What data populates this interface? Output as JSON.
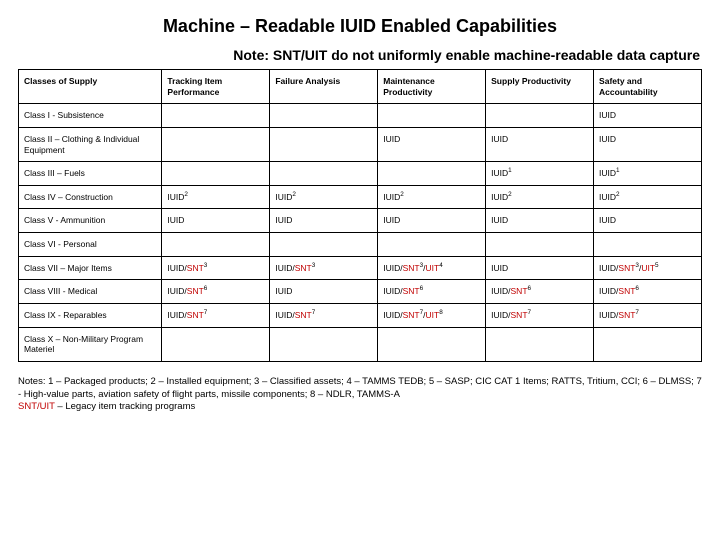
{
  "title": "Machine – Readable IUID Enabled Capabilities",
  "note_prefix": "Note: ",
  "note_body": "SNT/UIT do not uniformly enable machine-readable data capture",
  "headers": {
    "c0": "Classes of Supply",
    "c1": "Tracking Item Performance",
    "c2": "Failure Analysis",
    "c3": "Maintenance Productivity",
    "c4": "Supply Productivity",
    "c5": "Safety and Accountability"
  },
  "rows": [
    {
      "label": "Class I - Subsistence",
      "cells": [
        {
          "t": ""
        },
        {
          "t": ""
        },
        {
          "t": ""
        },
        {
          "t": ""
        },
        {
          "t": "IUID"
        }
      ]
    },
    {
      "label": "Class II – Clothing & Individual Equipment",
      "cells": [
        {
          "t": ""
        },
        {
          "t": ""
        },
        {
          "t": "IUID"
        },
        {
          "t": "IUID"
        },
        {
          "t": "IUID"
        }
      ]
    },
    {
      "label": "Class III – Fuels",
      "cells": [
        {
          "t": ""
        },
        {
          "t": ""
        },
        {
          "t": ""
        },
        {
          "t": "IUID",
          "sup": "1"
        },
        {
          "t": "IUID",
          "sup": "1"
        }
      ]
    },
    {
      "label": "Class IV – Construction",
      "cells": [
        {
          "t": "IUID",
          "sup": "2"
        },
        {
          "t": "IUID",
          "sup": "2"
        },
        {
          "t": "IUID",
          "sup": "2"
        },
        {
          "t": "IUID",
          "sup": "2"
        },
        {
          "t": "IUID",
          "sup": "2"
        }
      ]
    },
    {
      "label": "Class V - Ammunition",
      "cells": [
        {
          "t": "IUID"
        },
        {
          "t": "IUID"
        },
        {
          "t": "IUID"
        },
        {
          "t": "IUID"
        },
        {
          "t": "IUID"
        }
      ]
    },
    {
      "label": "Class VI - Personal",
      "cells": [
        {
          "t": ""
        },
        {
          "t": ""
        },
        {
          "t": ""
        },
        {
          "t": ""
        },
        {
          "t": ""
        }
      ]
    },
    {
      "label": "Class VII – Major Items",
      "cells": [
        {
          "t": "IUID/",
          "red": "SNT",
          "sup": "3"
        },
        {
          "t": "IUID/",
          "red": "SNT",
          "sup": "3"
        },
        {
          "t": "IUID/",
          "red": "SNT",
          "sup": "3",
          "suffix": "/",
          "red2": "UIT",
          "sup2": "4"
        },
        {
          "t": "IUID"
        },
        {
          "t": "IUID/",
          "red": "SNT",
          "sup": "3",
          "suffix": "/",
          "red2": "UIT",
          "sup2": "5"
        }
      ]
    },
    {
      "label": "Class VIII - Medical",
      "cells": [
        {
          "t": "IUID/",
          "red": "SNT",
          "sup": "6"
        },
        {
          "t": "IUID"
        },
        {
          "t": "IUID/",
          "red": "SNT",
          "sup": "6"
        },
        {
          "t": "IUID/",
          "red": "SNT",
          "sup": "6"
        },
        {
          "t": "IUID/",
          "red": "SNT",
          "sup": "6"
        }
      ]
    },
    {
      "label": "Class IX - Reparables",
      "cells": [
        {
          "t": "IUID/",
          "red": "SNT",
          "sup": "7"
        },
        {
          "t": "IUID/",
          "red": "SNT",
          "sup": "7"
        },
        {
          "t": "IUID/",
          "red": "SNT",
          "sup": "7",
          "suffix": "/",
          "red2": "UIT",
          "sup2": "8"
        },
        {
          "t": "IUID/",
          "red": "SNT",
          "sup": "7"
        },
        {
          "t": "IUID/",
          "red": "SNT",
          "sup": "7"
        }
      ]
    },
    {
      "label": "Class X – Non-Military Program Materiel",
      "cells": [
        {
          "t": ""
        },
        {
          "t": ""
        },
        {
          "t": ""
        },
        {
          "t": ""
        },
        {
          "t": ""
        }
      ]
    }
  ],
  "footnotes": {
    "lead": "Notes: 1 – Packaged products; 2 – Installed equipment; 3 – Classified assets; 4 – TAMMS TEDB; 5 – SASP; CIC CAT 1 Items; RATTS, Tritium, CCI; 6 – DLMSS; 7 - High-value parts, aviation safety of flight parts, missile components; 8 – NDLR, TAMMS-A",
    "red": "SNT/UIT",
    "tail": " – Legacy item tracking programs"
  }
}
